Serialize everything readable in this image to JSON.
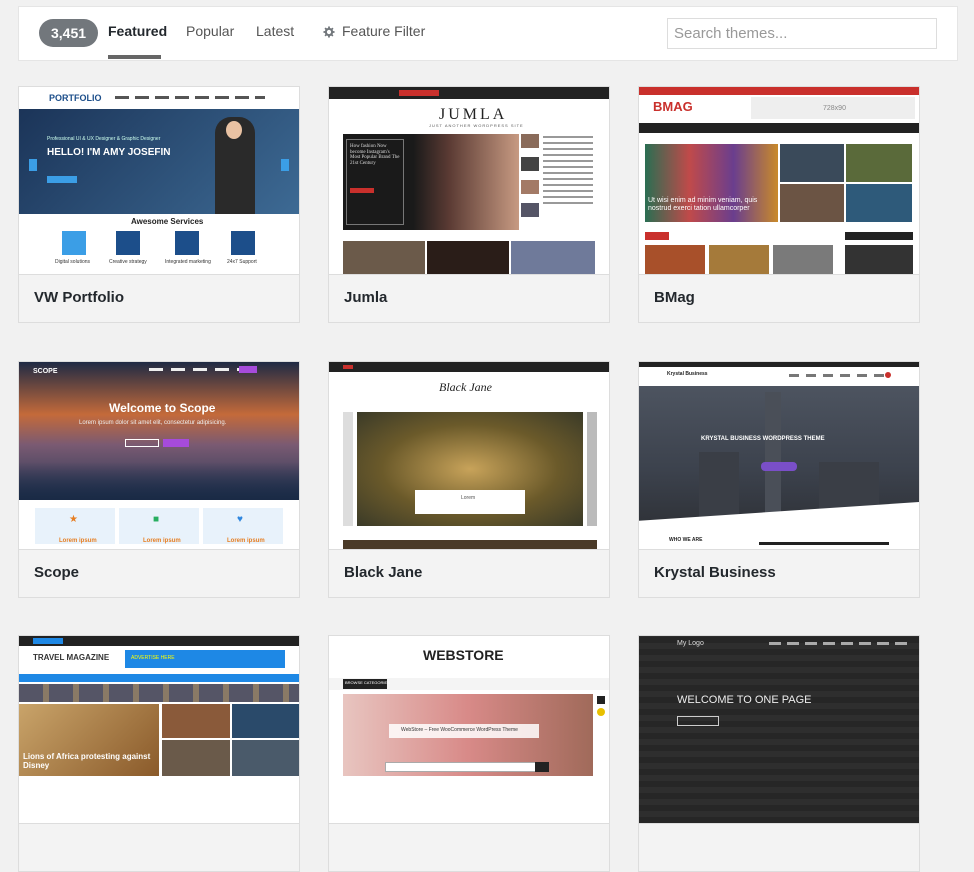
{
  "filter_bar": {
    "count": "3,451",
    "tabs": [
      "Featured",
      "Popular",
      "Latest"
    ],
    "active_tab": "Featured",
    "feature_filter_label": "Feature Filter",
    "search_placeholder": "Search themes..."
  },
  "themes": [
    {
      "name": "VW Portfolio",
      "preview": {
        "logo": "PORTFOLIO",
        "tagline": "Professional UI & UX Designer & Graphic Designer",
        "hero": "HELLO! I'M AMY JOSEFIN",
        "services_title": "Awesome Services",
        "services": [
          "Digital solutions",
          "Creative strategy",
          "Integrated marketing",
          "24x7 Support"
        ]
      }
    },
    {
      "name": "Jumla",
      "preview": {
        "logo": "JUMLA",
        "tagline": "JUST ANOTHER WORDPRESS SITE",
        "hero": "How fashion Now become Instagram's Most Popular Brand The 21st Century"
      }
    },
    {
      "name": "BMag",
      "preview": {
        "logo": "BMAG",
        "banner": "728x90",
        "hero": "Ut wisi enim ad minim veniam, quis nostrud exerci tation ullamcorper"
      }
    },
    {
      "name": "Scope",
      "preview": {
        "logo": "SCOPE",
        "hero": "Welcome to Scope",
        "sub": "Lorem ipsum dolor sit amet elit, consectetur adipisicing.",
        "items": [
          "Lorem ipsum",
          "Lorem ipsum",
          "Lorem ipsum"
        ]
      }
    },
    {
      "name": "Black Jane",
      "preview": {
        "logo": "Black Jane",
        "caption": "Lorem"
      }
    },
    {
      "name": "Krystal Business",
      "preview": {
        "logo": "Krystal Business",
        "hero": "KRYSTAL BUSINESS WORDPRESS THEME",
        "section": "WHO WE ARE"
      }
    },
    {
      "name": "",
      "preview": {
        "logo": "TRAVEL MAGAZINE",
        "ad": "ADVERTISE HERE",
        "hero": "Lions of Africa protesting against Disney"
      }
    },
    {
      "name": "",
      "preview": {
        "logo": "WEBSTORE",
        "tagline": "WebStore – Free WooCommerce WordPress Theme",
        "menu": "BROWSE CATEGORIES"
      }
    },
    {
      "name": "",
      "preview": {
        "logo": "My Logo",
        "hero": "WELCOME TO ONE PAGE"
      }
    }
  ]
}
